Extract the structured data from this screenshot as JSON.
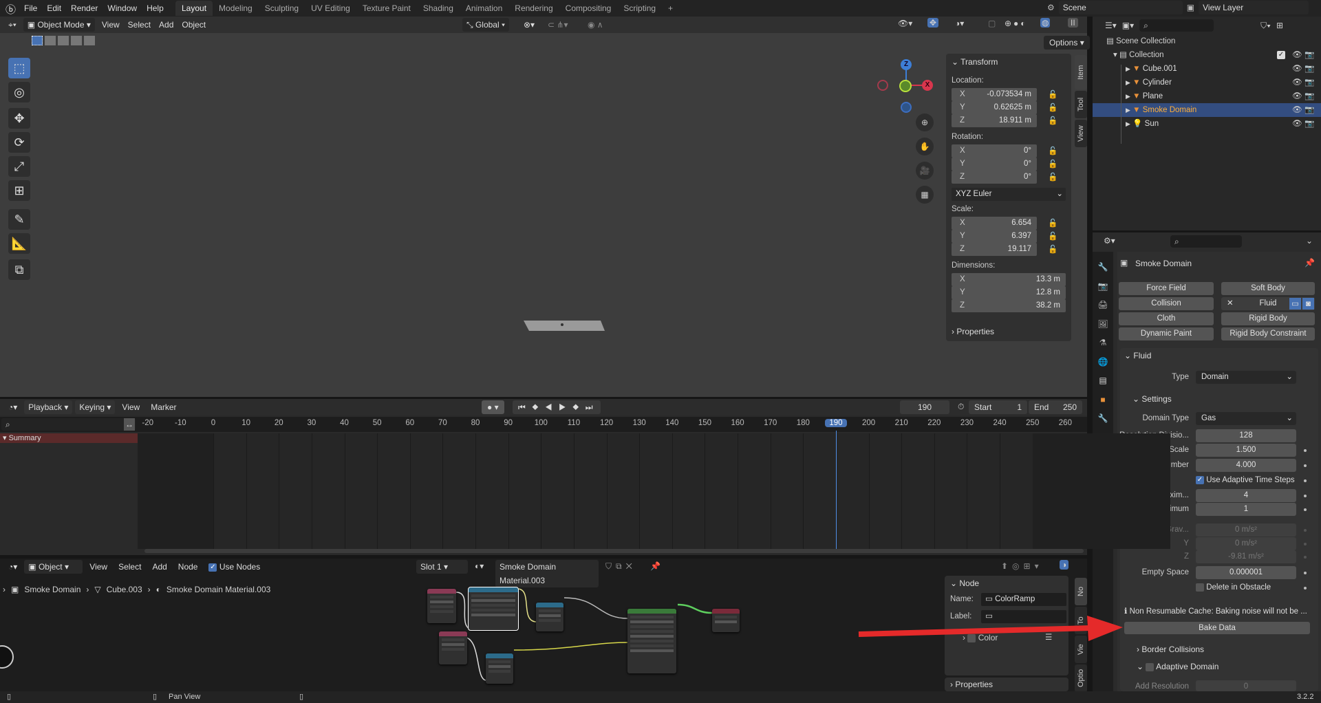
{
  "topbar": {
    "menus": [
      "File",
      "Edit",
      "Render",
      "Window",
      "Help"
    ],
    "workspaces": [
      "Layout",
      "Modeling",
      "Sculpting",
      "UV Editing",
      "Texture Paint",
      "Shading",
      "Animation",
      "Rendering",
      "Compositing",
      "Scripting"
    ],
    "active_workspace": "Layout",
    "add_tab": "+",
    "scene": "Scene",
    "view_layer": "View Layer"
  },
  "viewport_header": {
    "mode": "Object Mode",
    "menus": [
      "View",
      "Select",
      "Add",
      "Object"
    ],
    "orientation": "Global",
    "options": "Options"
  },
  "n_panel": {
    "tabs": [
      "Item",
      "Tool",
      "View"
    ],
    "transform_title": "Transform",
    "location_label": "Location:",
    "location": [
      {
        "axis": "X",
        "value": "-0.073534 m"
      },
      {
        "axis": "Y",
        "value": "0.62625 m"
      },
      {
        "axis": "Z",
        "value": "18.911 m"
      }
    ],
    "rotation_label": "Rotation:",
    "rotation": [
      {
        "axis": "X",
        "value": "0°"
      },
      {
        "axis": "Y",
        "value": "0°"
      },
      {
        "axis": "Z",
        "value": "0°"
      }
    ],
    "rotation_mode": "XYZ Euler",
    "scale_label": "Scale:",
    "scale": [
      {
        "axis": "X",
        "value": "6.654"
      },
      {
        "axis": "Y",
        "value": "6.397"
      },
      {
        "axis": "Z",
        "value": "19.117"
      }
    ],
    "dimensions_label": "Dimensions:",
    "dimensions": [
      {
        "axis": "X",
        "value": "13.3 m"
      },
      {
        "axis": "Y",
        "value": "12.8 m"
      },
      {
        "axis": "Z",
        "value": "38.2 m"
      }
    ],
    "properties_title": "Properties"
  },
  "gizmo": {
    "z": "Z",
    "x": "X"
  },
  "outliner": {
    "scene_collection": "Scene Collection",
    "collection": "Collection",
    "items": [
      {
        "name": "Cube.001",
        "selected": false
      },
      {
        "name": "Cylinder",
        "selected": false
      },
      {
        "name": "Plane",
        "selected": false
      },
      {
        "name": "Smoke Domain",
        "selected": true
      },
      {
        "name": "Sun",
        "selected": false
      }
    ]
  },
  "properties": {
    "object_name": "Smoke Domain",
    "physics_buttons": [
      [
        "Force Field",
        "Soft Body"
      ],
      [
        "Collision",
        "Fluid"
      ],
      [
        "Cloth",
        "Rigid Body"
      ],
      [
        "Dynamic Paint",
        "Rigid Body Constraint"
      ]
    ],
    "fluid_title": "Fluid",
    "type_label": "Type",
    "type_value": "Domain",
    "settings_title": "Settings",
    "rows": [
      {
        "label": "Domain Type",
        "value": "Gas",
        "kind": "drop"
      },
      {
        "label": "Resolution Divisio...",
        "value": "128",
        "kind": "num"
      },
      {
        "label": "Time Scale",
        "value": "1.500",
        "kind": "num",
        "dot": true
      },
      {
        "label": "CFL Number",
        "value": "4.000",
        "kind": "num",
        "dot": true
      },
      {
        "label": "",
        "value": "Use Adaptive Time Steps",
        "kind": "check",
        "checked": true,
        "dot": true
      },
      {
        "label": "Timesteps Maxim...",
        "value": "4",
        "kind": "num",
        "dot": true
      },
      {
        "label": "Minimum",
        "value": "1",
        "kind": "num",
        "dot": true
      },
      {
        "label": "Using Scene Grav...",
        "value": "0 m/s²",
        "kind": "dim",
        "dot": true
      },
      {
        "label": "Y",
        "value": "0 m/s²",
        "kind": "dim",
        "dot": true
      },
      {
        "label": "Z",
        "value": "-9.81 m/s²",
        "kind": "dim",
        "dot": true
      },
      {
        "label": "Empty Space",
        "value": "0.000001",
        "kind": "num",
        "dot": true
      },
      {
        "label": "",
        "value": "Delete in Obstacle",
        "kind": "check",
        "checked": false,
        "dot": true
      }
    ],
    "warning": "Non Resumable Cache: Baking noise will not be ...",
    "bake_button": "Bake Data",
    "border_collisions": "Border Collisions",
    "adaptive_domain": "Adaptive Domain",
    "add_resolution_label": "Add Resolution",
    "add_resolution_value": "0"
  },
  "timeline": {
    "menus": [
      "Playback",
      "Keying",
      "View",
      "Marker"
    ],
    "current_frame": "190",
    "start_label": "Start",
    "start": "1",
    "end_label": "End",
    "end": "250",
    "ticks": [
      -20,
      -10,
      0,
      10,
      20,
      30,
      40,
      50,
      60,
      70,
      80,
      90,
      100,
      110,
      120,
      130,
      140,
      150,
      160,
      170,
      180,
      190,
      200,
      210,
      220,
      230,
      240,
      250,
      260
    ],
    "summary": "Summary"
  },
  "node_editor": {
    "type": "Object",
    "menus": [
      "View",
      "Select",
      "Add",
      "Node"
    ],
    "use_nodes": "Use Nodes",
    "slot": "Slot 1",
    "material": "Smoke Domain Material.003",
    "breadcrumb": [
      "Smoke Domain",
      "Cube.003",
      "Smoke Domain Material.003"
    ],
    "side_tabs": [
      "No",
      "To",
      "Vie",
      "Optio"
    ],
    "node_panel_title": "Node",
    "name_label": "Name:",
    "name_value": "ColorRamp",
    "label_label": "Label:",
    "color_label": "Color",
    "properties_title": "Properties"
  },
  "status": {
    "hint": "Pan View",
    "version": "3.2.2"
  },
  "colors": {
    "accent": "#4772b3",
    "selected_row": "#334d80",
    "arrow": "#e52a2a"
  }
}
